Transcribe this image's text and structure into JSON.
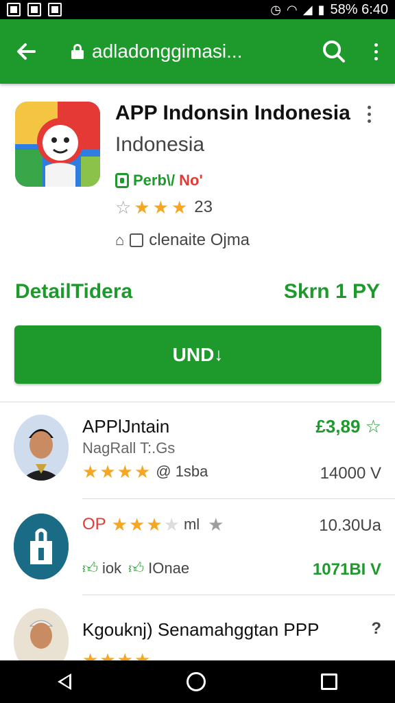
{
  "status_bar": {
    "battery_time": "58% 6:40"
  },
  "app_bar": {
    "url": "adladonggimasi..."
  },
  "app": {
    "title": "APP Indonsin Indonesia",
    "subtitle": "Indonesia",
    "badge_label": "Perb\\/",
    "badge_no": "No'",
    "rating_count": "23",
    "meta_text": "clenaite Ojma",
    "stars": 3.5
  },
  "detail": {
    "label": "DetailTidera",
    "price": "Skrn 1 PY"
  },
  "install_button": {
    "label": "UND"
  },
  "list": [
    {
      "title": "APPlJntain",
      "sub": "NagRall T:.Gs",
      "rating_text": "@ 1sba",
      "price": "£3,89",
      "count": "14000 V"
    },
    {
      "title": "OP",
      "rating_text": "ml",
      "right_top": "10.30Ua",
      "left_bottom_1": "iok",
      "left_bottom_2": "IOnae",
      "right_bottom": "1071BI V"
    },
    {
      "title": "Kgouknj) Senamahggtan PPP",
      "right_mark": "?"
    }
  ],
  "colors": {
    "primary": "#1e9a2c",
    "star": "#f5a623",
    "accent_red": "#e53935"
  }
}
